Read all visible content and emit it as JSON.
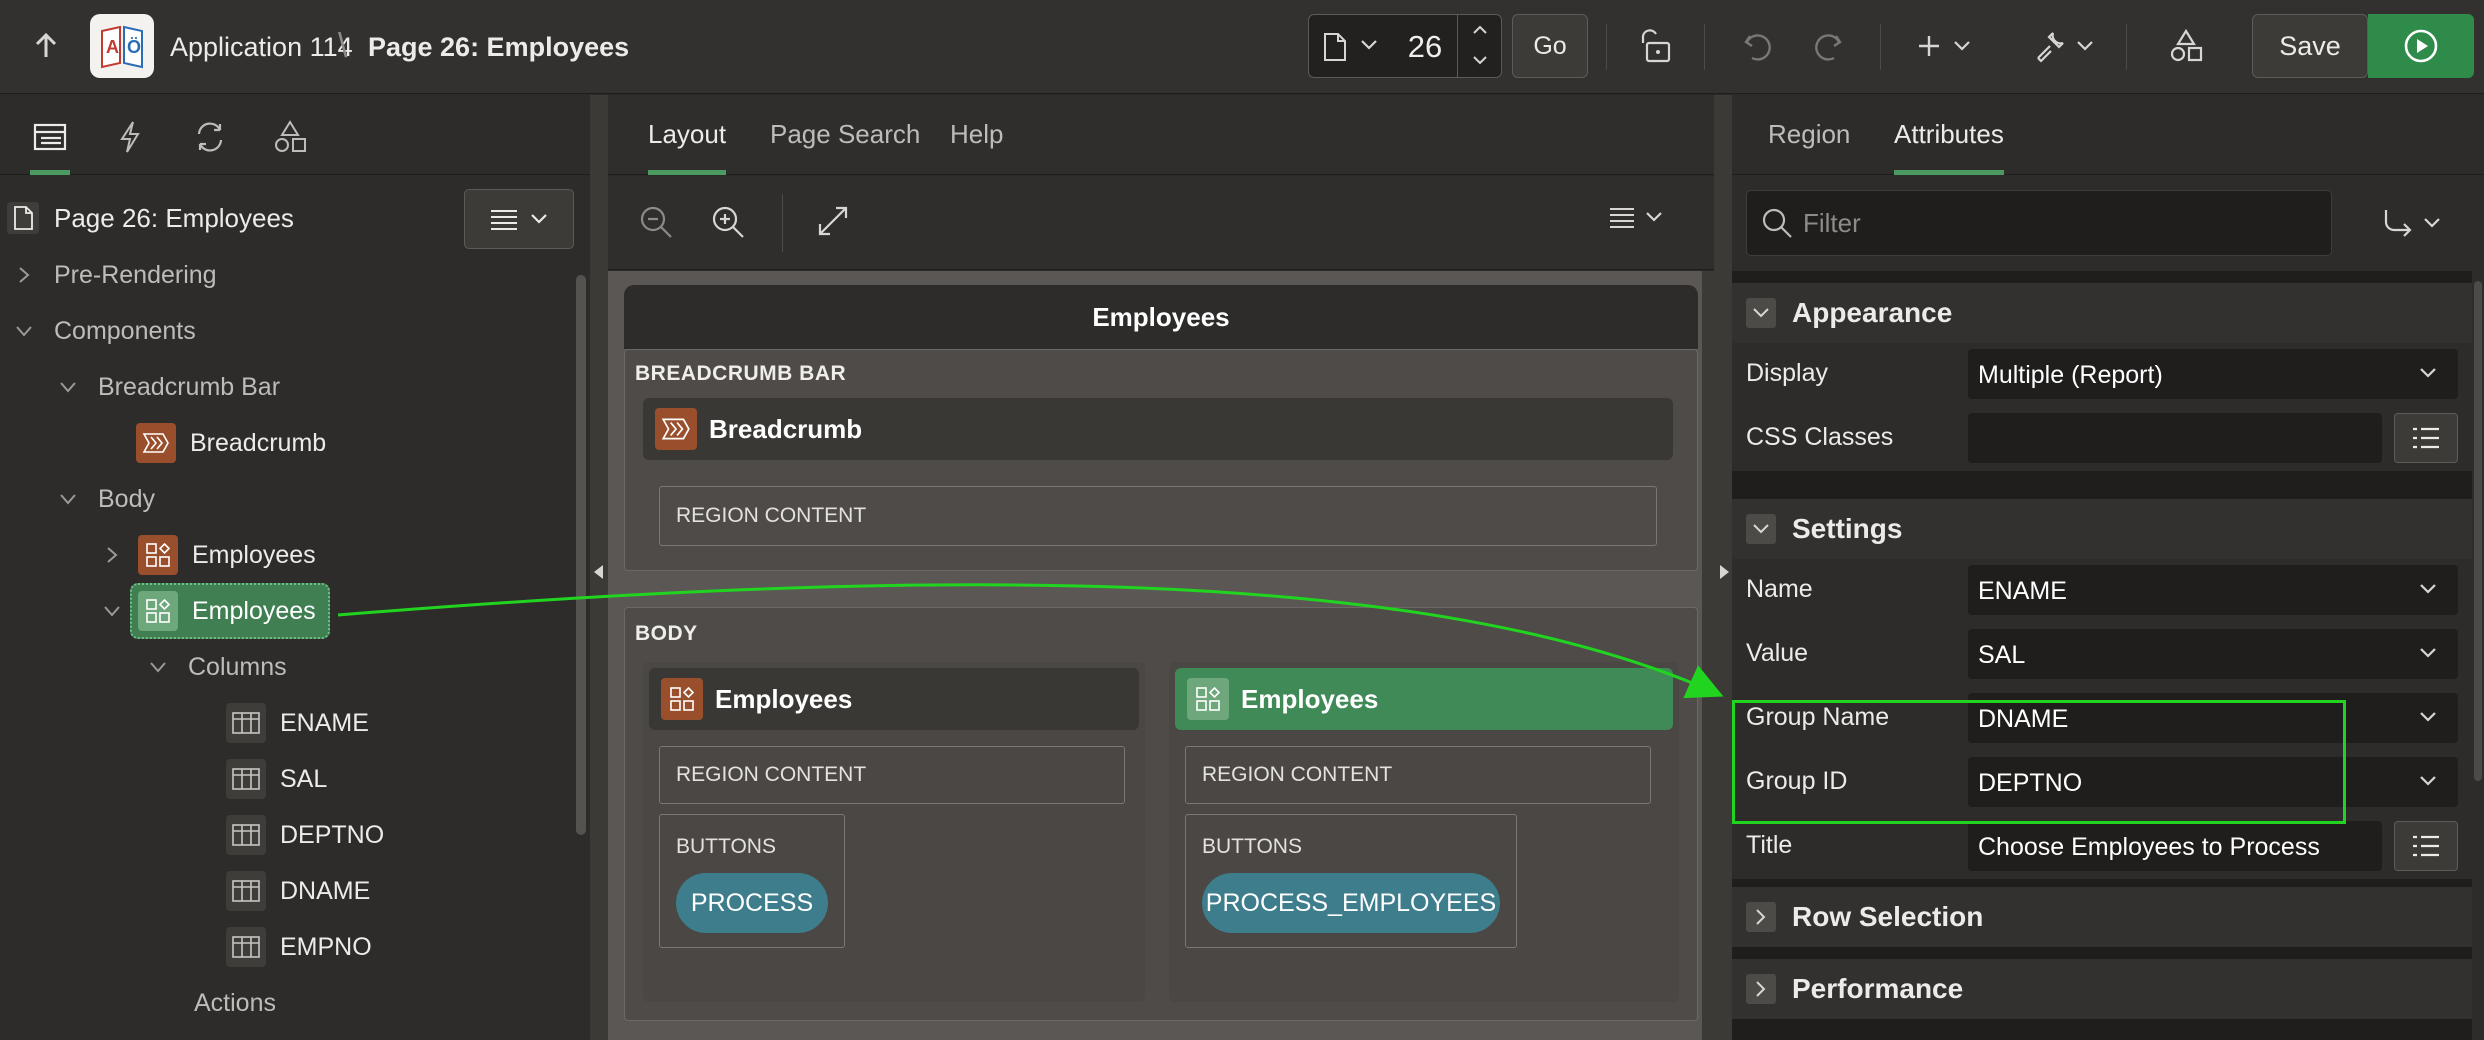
{
  "header": {
    "app_name": "Application 114",
    "separator": "\\",
    "page_name": "Page 26: Employees",
    "page_number": "26",
    "go_label": "Go",
    "save_label": "Save"
  },
  "left_panel": {
    "root_label": "Page 26: Employees",
    "tree": {
      "pre_rendering": "Pre-Rendering",
      "components": "Components",
      "breadcrumb_bar": "Breadcrumb Bar",
      "breadcrumb": "Breadcrumb",
      "body": "Body",
      "employees_1": "Employees",
      "employees_2": "Employees",
      "columns": "Columns",
      "col_ename": "ENAME",
      "col_sal": "SAL",
      "col_deptno": "DEPTNO",
      "col_dname": "DNAME",
      "col_empno": "EMPNO",
      "actions": "Actions"
    }
  },
  "center_panel": {
    "tabs": {
      "layout": "Layout",
      "page_search": "Page Search",
      "help": "Help"
    },
    "page_title": "Employees",
    "breadcrumb_bar_label": "BREADCRUMB BAR",
    "breadcrumb_region": "Breadcrumb",
    "region_content": "REGION CONTENT",
    "body_label": "BODY",
    "left_region": {
      "title": "Employees",
      "content": "REGION CONTENT",
      "buttons_label": "BUTTONS",
      "button": "PROCESS"
    },
    "right_region": {
      "title": "Employees",
      "content": "REGION CONTENT",
      "buttons_label": "BUTTONS",
      "button": "PROCESS_EMPLOYEES"
    }
  },
  "right_panel": {
    "tabs": {
      "region": "Region",
      "attributes": "Attributes"
    },
    "filter_placeholder": "Filter",
    "appearance": {
      "title": "Appearance",
      "display_label": "Display",
      "display_value": "Multiple (Report)",
      "css_label": "CSS Classes",
      "css_value": ""
    },
    "settings": {
      "title": "Settings",
      "name_label": "Name",
      "name_value": "ENAME",
      "value_label": "Value",
      "value_value": "SAL",
      "group_name_label": "Group Name",
      "group_name_value": "DNAME",
      "group_id_label": "Group ID",
      "group_id_value": "DEPTNO",
      "title_label": "Title",
      "title_value": "Choose Employees to Process"
    },
    "row_selection": "Row Selection",
    "performance": "Performance"
  },
  "colors": {
    "accent_green": "#4a9a62",
    "run_green": "#2f8b4a",
    "annotation_green": "#21d41f",
    "region_orange": "#a0522d",
    "pill_teal": "#3e7d8c"
  },
  "icons": [
    "arrow-up-icon",
    "app-icon",
    "page-icon",
    "chevron-down-icon",
    "spin-up-icon",
    "spin-down-icon",
    "lock-icon",
    "undo-icon",
    "redo-icon",
    "plus-icon",
    "wrench-icon",
    "shapes-icon",
    "run-icon",
    "rendering-tree-icon",
    "dynamic-actions-icon",
    "processing-icon",
    "shared-components-icon",
    "menu-icon",
    "zoom-out-icon",
    "zoom-in-icon",
    "expand-icon",
    "search-icon",
    "goto-group-icon",
    "list-icon"
  ]
}
